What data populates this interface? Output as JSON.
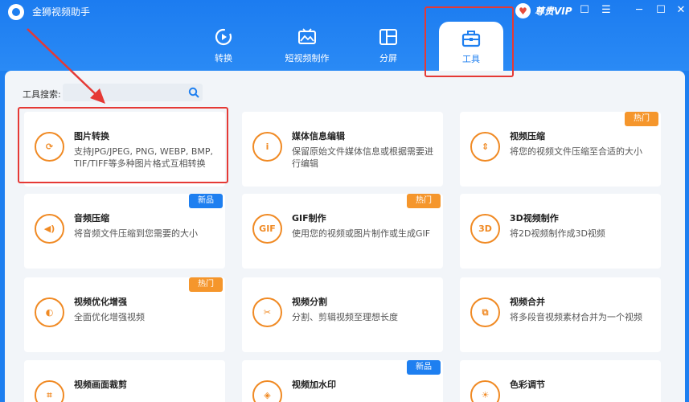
{
  "app": {
    "title": "金狮视频助手",
    "vip_label": "尊贵VIP"
  },
  "window_controls": [
    "☐",
    "☰",
    "─",
    "☐",
    "✕"
  ],
  "tabs": [
    {
      "label": "转换",
      "icon": "convert-icon"
    },
    {
      "label": "短视频制作",
      "icon": "short-video-icon"
    },
    {
      "label": "分屏",
      "icon": "split-screen-icon"
    },
    {
      "label": "工具",
      "icon": "toolbox-icon",
      "active": true
    }
  ],
  "search": {
    "label": "工具搜索:",
    "value": ""
  },
  "tools": [
    {
      "title": "图片转换",
      "desc": "支持JPG/JPEG, PNG, WEBP, BMP, TIF/TIFF等多种图片格式互相转换",
      "icon_text": "⟳",
      "badge": ""
    },
    {
      "title": "媒体信息编辑",
      "desc": "保留原始文件媒体信息或根据需要进行编辑",
      "icon_text": "i",
      "badge": ""
    },
    {
      "title": "视频压缩",
      "desc": "将您的视频文件压缩至合适的大小",
      "icon_text": "⇕",
      "badge": "热门"
    },
    {
      "title": "音频压缩",
      "desc": "将音频文件压缩到您需要的大小",
      "icon_text": "◀)",
      "badge": "新品"
    },
    {
      "title": "GIF制作",
      "desc": "使用您的视频或图片制作或生成GIF",
      "icon_text": "GIF",
      "badge": "热门"
    },
    {
      "title": "3D视频制作",
      "desc": "将2D视频制作成3D视频",
      "icon_text": "3D",
      "badge": ""
    },
    {
      "title": "视频优化增强",
      "desc": "全面优化增强视频",
      "icon_text": "◐",
      "badge": "热门"
    },
    {
      "title": "视频分割",
      "desc": "分割、剪辑视频至理想长度",
      "icon_text": "✂",
      "badge": ""
    },
    {
      "title": "视频合并",
      "desc": "将多段音视频素材合并为一个视频",
      "icon_text": "⧉",
      "badge": ""
    },
    {
      "title": "视频画面裁剪",
      "desc": "",
      "icon_text": "⌗",
      "badge": ""
    },
    {
      "title": "视频加水印",
      "desc": "",
      "icon_text": "◈",
      "badge": "新品"
    },
    {
      "title": "色彩调节",
      "desc": "",
      "icon_text": "☀",
      "badge": ""
    }
  ],
  "colors": {
    "brand": "#1e7ff0",
    "accent": "#f08a24",
    "hot_badge": "#f5962c",
    "new_badge": "#1e7ff0",
    "annotation": "#e53935"
  }
}
